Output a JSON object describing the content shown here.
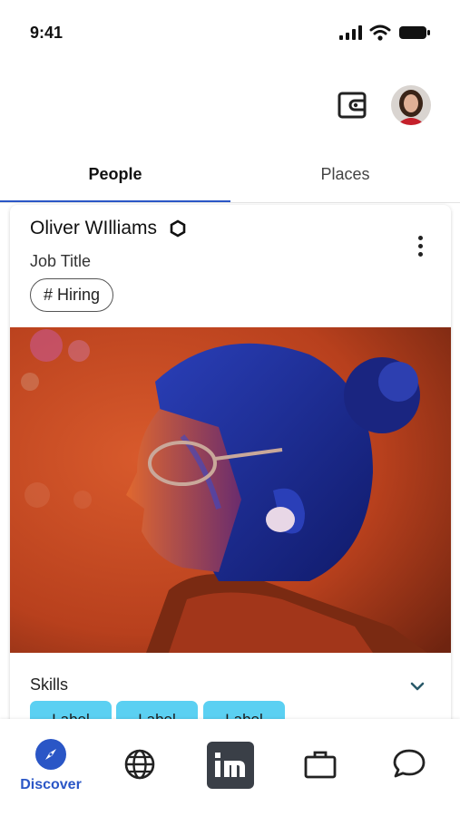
{
  "status_bar": {
    "time": "9:41"
  },
  "header": {
    "wallet_icon": "wallet-icon",
    "avatar": "profile-avatar"
  },
  "tabs": [
    {
      "label": "People",
      "active": true
    },
    {
      "label": "Places",
      "active": false
    }
  ],
  "card": {
    "name": "Oliver WIlliams",
    "badge_icon": "hexagon-icon",
    "job_title": "Job Title",
    "tag": "# Hiring",
    "skills": {
      "label": "Skills",
      "chips": [
        "Label",
        "Label",
        "Label"
      ]
    }
  },
  "bottom_nav": {
    "items": [
      {
        "label": "Discover",
        "icon": "compass-icon",
        "active": true
      },
      {
        "label": "",
        "icon": "globe-icon"
      },
      {
        "label": "",
        "icon": "brand-logo-icon"
      },
      {
        "label": "",
        "icon": "briefcase-icon"
      },
      {
        "label": "",
        "icon": "chat-bubble-icon"
      }
    ]
  },
  "colors": {
    "accent": "#2a56c6",
    "chip": "#5bd0f2",
    "brand_tile": "#3a3f47"
  }
}
